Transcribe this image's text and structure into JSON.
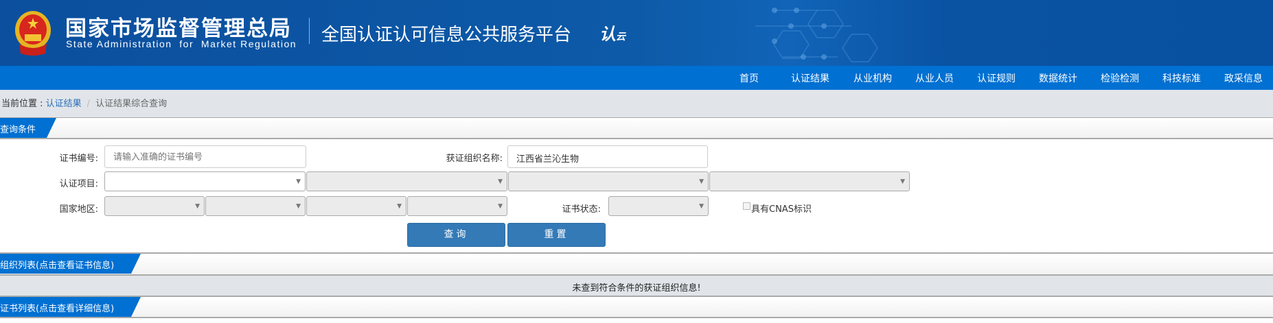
{
  "header": {
    "title_cn": "国家市场监督管理总局",
    "title_en": "State Administration  for  Market Regulation",
    "platform": "全国认证认可信息公共服务平台",
    "platform_logo": "认云"
  },
  "nav": {
    "items": [
      "首页",
      "认证结果",
      "从业机构",
      "从业人员",
      "认证规则",
      "数据统计",
      "检验检测",
      "科技标准",
      "政采信息"
    ]
  },
  "breadcrumb": {
    "prefix": "当前位置 : ",
    "link": "认证结果",
    "separator": "/",
    "current": "认证结果综合查询"
  },
  "query": {
    "section_title": "查询条件",
    "cert_no_label": "证书编号:",
    "cert_no_placeholder": "请输入准确的证书编号",
    "cert_no_value": "",
    "org_name_label": "获证组织名称:",
    "org_name_value": "江西省兰沁生物",
    "project_label": "认证项目:",
    "region_label": "国家地区:",
    "status_label": "证书状态:",
    "cnas_label": "具有CNAS标识",
    "search_button": "查询",
    "reset_button": "重置"
  },
  "org_list": {
    "section_title": "组织列表(点击查看证书信息)",
    "empty_message": "未查到符合条件的获证组织信息!"
  },
  "cert_list": {
    "section_title": "证书列表(点击查看详细信息)"
  },
  "colors": {
    "header": "#0b4f9e",
    "nav": "#0070d2",
    "button": "#337ab7",
    "crumb_bg": "#e1e5ea"
  }
}
